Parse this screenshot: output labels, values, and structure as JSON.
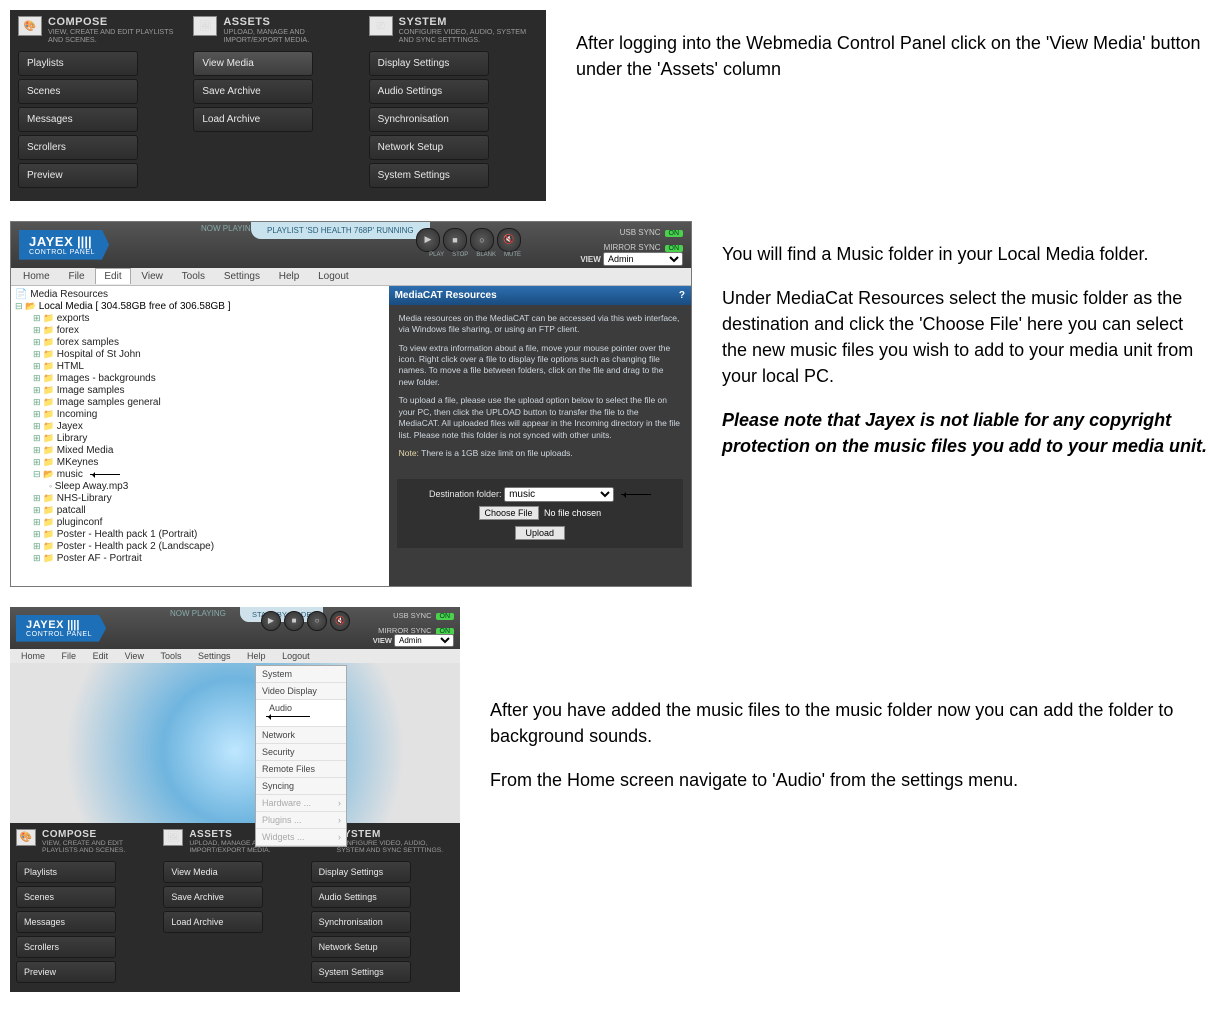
{
  "doc": {
    "p1": "After logging into the Webmedia Control Panel click on the 'View Media' button under the 'Assets' column",
    "p2a": "You will find a Music folder in your Local Media folder.",
    "p2b": "Under MediaCat Resources select the music folder as the destination and click the 'Choose File' here you can select the new music files you wish to add to your media unit from your local PC.",
    "p2c": "Please note that Jayex is not liable for any copyright protection on the music files you add to your media unit.",
    "p3a": "After you have added the music files to the music folder now you can add the folder to background sounds.",
    "p3b": "From the Home screen navigate to 'Audio' from the settings menu."
  },
  "cols": {
    "compose": {
      "title": "COMPOSE",
      "sub": "VIEW, CREATE AND EDIT PLAYLISTS AND SCENES.",
      "items": [
        "Playlists",
        "Scenes",
        "Messages",
        "Scrollers",
        "Preview"
      ]
    },
    "assets": {
      "title": "ASSETS",
      "sub": "UPLOAD, MANAGE AND IMPORT/EXPORT MEDIA.",
      "items": [
        "View Media",
        "Save Archive",
        "Load Archive"
      ],
      "selected": 0
    },
    "system": {
      "title": "SYSTEM",
      "sub": "CONFIGURE VIDEO, AUDIO, SYSTEM AND SYNC SETTTINGS.",
      "items": [
        "Display Settings",
        "Audio Settings",
        "Synchronisation",
        "Network Setup",
        "System Settings"
      ]
    }
  },
  "app": {
    "brand": "JAYEX",
    "brand_sub": "CONTROL PANEL",
    "now_playing_label": "NOW PLAYING",
    "now_playing_value": "PLAYLIST 'SD HEALTH 768P' RUNNING",
    "standby": "STANDBY MODE",
    "transport": {
      "play": "PLAY",
      "stop": "STOP",
      "blank": "BLANK",
      "mute": "MUTE"
    },
    "usb_sync": "USB SYNC",
    "mirror_sync": "MIRROR SYNC",
    "on": "ON",
    "view_label": "VIEW",
    "view_value": "Admin",
    "menu": [
      "Home",
      "File",
      "Edit",
      "View",
      "Tools",
      "Settings",
      "Help",
      "Logout"
    ],
    "menu_active_panel2": "Edit"
  },
  "tree": {
    "title": "Media Resources",
    "root": "Local Media [ 304.58GB free of 306.58GB ]",
    "items": [
      "exports",
      "forex",
      "forex samples",
      "Hospital of St John",
      "HTML",
      "Images - backgrounds",
      "Image samples",
      "Image samples general",
      "Incoming",
      "Jayex",
      "Library",
      "Mixed Media",
      "MKeynes"
    ],
    "music": "music",
    "music_child": "Sleep Away.mp3",
    "items_after": [
      "NHS-Library",
      "patcall",
      "pluginconf",
      "Poster - Health pack 1 (Portrait)",
      "Poster - Health pack 2 (Landscape)",
      "Poster AF - Portrait"
    ]
  },
  "mediacat": {
    "title": "MediaCAT Resources",
    "p1": "Media resources on the MediaCAT can be accessed via this web interface, via Windows file sharing, or using an FTP client.",
    "p2": "To view extra information about a file, move your mouse pointer over the icon. Right click over a file to display file options such as changing file names. To move a file between folders, click on the file and drag to the new folder.",
    "p3": "To upload a file, please use the upload option below to select the file on your PC, then click the UPLOAD button to transfer the file to the MediaCAT. All uploaded files will appear in the Incoming directory in the file list. Please note this folder is not synced with other units.",
    "note_label": "Note:",
    "note": " There is a 1GB size limit on file uploads.",
    "dest_label": "Destination folder:",
    "dest_value": "music",
    "choose": "Choose File",
    "nofile": "No file chosen",
    "upload": "Upload"
  },
  "settings_menu": {
    "items": [
      "System",
      "Video Display",
      "Audio",
      "Network",
      "Security",
      "Remote Files",
      "Syncing"
    ],
    "sub_items": [
      "Hardware ...",
      "Plugins ...",
      "Widgets ..."
    ],
    "selected": "Audio"
  }
}
